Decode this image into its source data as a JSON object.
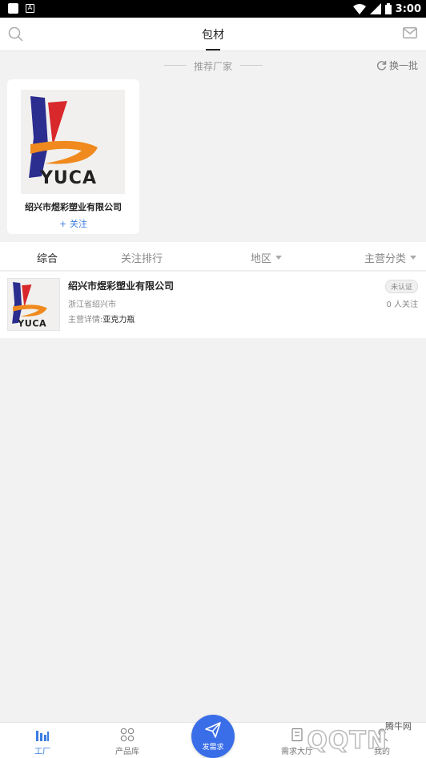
{
  "status_bar": {
    "time": "3:00"
  },
  "header": {
    "title": "包材"
  },
  "recommend": {
    "title": "推荐厂家",
    "refresh_label": "换一批"
  },
  "featured_card": {
    "logo_text": "YUCA",
    "company_name": "绍兴市煜彩塑业有限公司",
    "follow_label": "+ 关注"
  },
  "filters": [
    {
      "label": "综合"
    },
    {
      "label": "关注排行"
    },
    {
      "label": "地区"
    },
    {
      "label": "主营分类"
    }
  ],
  "list": [
    {
      "logo_text": "YUCA",
      "company_name": "绍兴市煜彩塑业有限公司",
      "location": "浙江省绍兴市",
      "business_label": "主营详情:",
      "business_value": "亚克力瓶",
      "badge": "未认证",
      "followers": "0 人关注"
    }
  ],
  "tabbar": {
    "tabs": [
      {
        "label": "工厂"
      },
      {
        "label": "产品库"
      },
      {
        "label": "需求大厅"
      },
      {
        "label": "我的"
      }
    ],
    "publish_label": "发需求"
  },
  "watermark": {
    "brand_cn": "腾牛网",
    "brand_en": "QQTN"
  },
  "colors": {
    "accent": "#3a7de0",
    "fab": "#3a6ee8",
    "background": "#f2f2f2"
  }
}
